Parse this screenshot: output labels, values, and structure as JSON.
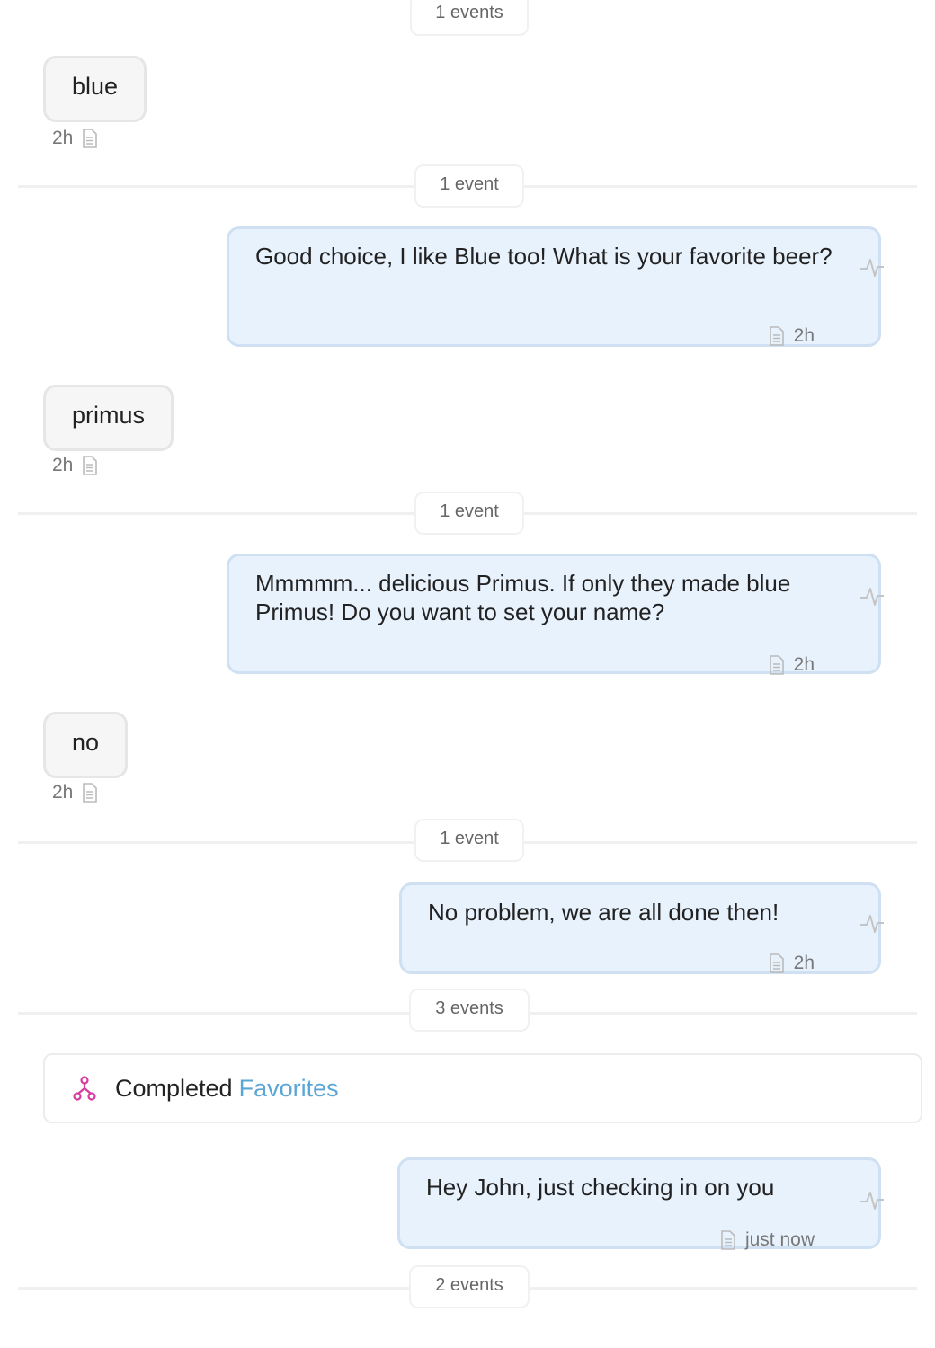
{
  "top_divider": {
    "label": "1 events"
  },
  "timeline": [
    {
      "type": "incoming",
      "text": "blue",
      "time": "2h"
    },
    {
      "type": "divider",
      "label": "1 event"
    },
    {
      "type": "outgoing",
      "text": "Good choice, I like Blue too! What is your favorite beer?",
      "time": "2h"
    },
    {
      "type": "incoming",
      "text": "primus",
      "time": "2h"
    },
    {
      "type": "divider",
      "label": "1 event"
    },
    {
      "type": "outgoing",
      "text": "Mmmmm... delicious Primus. If only they made blue Primus! Do you want to set your name?",
      "time": "2h"
    },
    {
      "type": "incoming",
      "text": "no",
      "time": "2h"
    },
    {
      "type": "divider",
      "label": "1 event"
    },
    {
      "type": "outgoing",
      "text": "No problem, we are all done then!",
      "time": "2h"
    },
    {
      "type": "divider",
      "label": "3 events"
    },
    {
      "type": "flow",
      "prefix": "Completed",
      "flow_name": "Favorites"
    },
    {
      "type": "outgoing",
      "text": "Hey John, just checking in on you",
      "time": "just now"
    },
    {
      "type": "divider",
      "label": "2 events"
    }
  ],
  "colors": {
    "outgoing_bg": "#e8f2fd",
    "outgoing_border": "#cfe0f2",
    "incoming_bg": "#f6f6f6",
    "link": "#5aa6d6",
    "flow_icon": "#d63ca0"
  },
  "icons": {
    "message_log": "document-icon",
    "activity": "pulse-icon",
    "flow": "flow-icon"
  }
}
